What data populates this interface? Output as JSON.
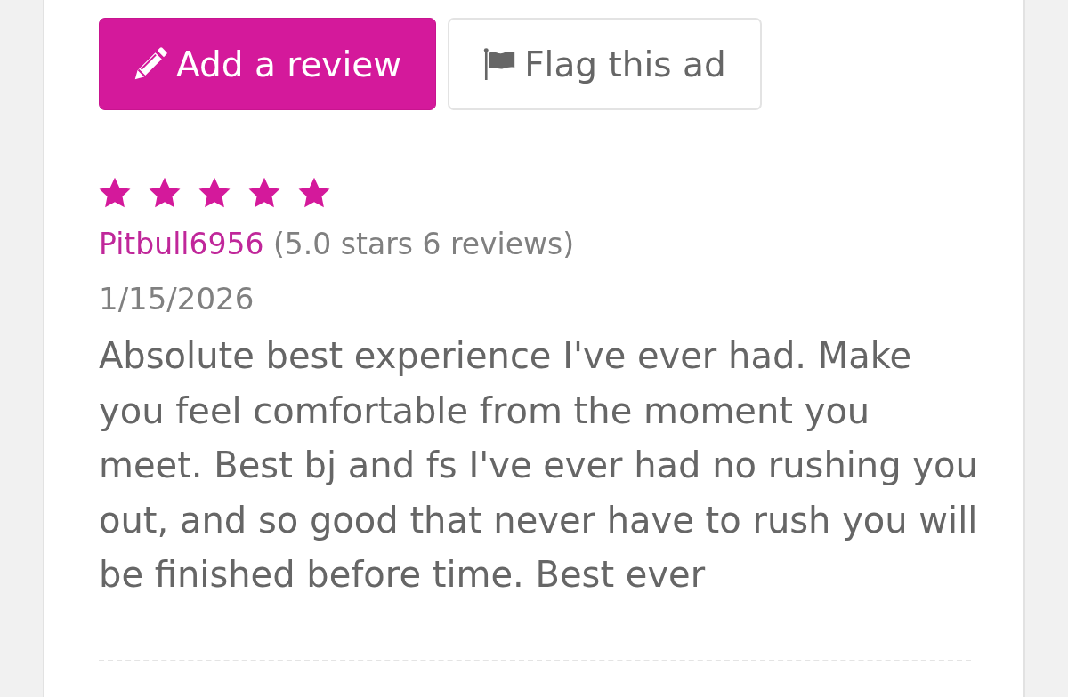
{
  "actions": [
    {
      "kind": "review",
      "label": "Add a review"
    },
    {
      "kind": "flag",
      "label": "Flag this ad"
    }
  ],
  "review": {
    "stars": 5,
    "author": "Pitbull6956",
    "author_stats": "(5.0 stars 6 reviews)",
    "date": "1/15/2026",
    "text": "Absolute best experience I've ever had. Make you feel comfortable from the moment you meet. Best bj and fs I've ever had no rushing you out, and so good that never have to rush you will be finished before time. Best ever"
  }
}
